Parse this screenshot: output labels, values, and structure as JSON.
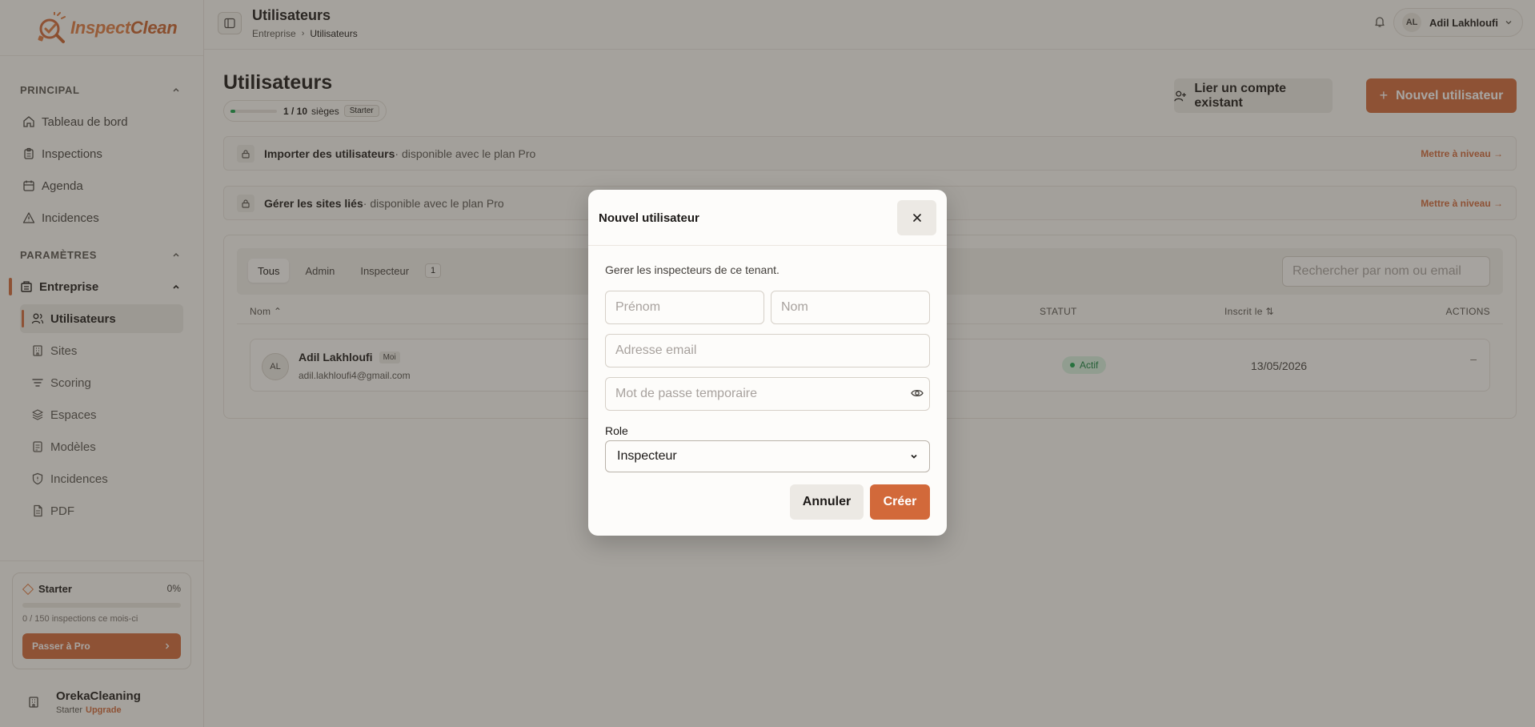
{
  "app": {
    "brand_part1": "Inspect",
    "brand_part2": "Clean",
    "accent_color": "#d2693a"
  },
  "sidebar": {
    "section_principal": "PRINCIPAL",
    "principal_items": [
      {
        "label": "Tableau de bord",
        "icon": "home-icon"
      },
      {
        "label": "Inspections",
        "icon": "clipboard-icon"
      },
      {
        "label": "Agenda",
        "icon": "calendar-icon"
      },
      {
        "label": "Incidences",
        "icon": "alert-triangle-icon"
      }
    ],
    "section_params": "PARAMÈTRES",
    "parent_item": "Entreprise",
    "sub_items": [
      {
        "label": "Utilisateurs",
        "icon": "users-icon"
      },
      {
        "label": "Sites",
        "icon": "building-icon"
      },
      {
        "label": "Scoring",
        "icon": "chart-icon"
      },
      {
        "label": "Espaces",
        "icon": "layers-icon"
      },
      {
        "label": "Modèles",
        "icon": "template-icon"
      },
      {
        "label": "Incidences",
        "icon": "shield-icon"
      },
      {
        "label": "PDF",
        "icon": "file-icon"
      }
    ],
    "plan": {
      "name": "Starter",
      "percent": "0%",
      "usage_fraction": 0,
      "usage": "0 / 150 inspections ce mois-ci",
      "upgrade_label": "Passer à Pro"
    },
    "org": {
      "name": "OrekaCleaning",
      "plan": "Starter",
      "upgrade": "Upgrade"
    }
  },
  "header": {
    "title": "Utilisateurs",
    "breadcrumb_root": "Entreprise",
    "breadcrumb_current": "Utilisateurs",
    "user_initials": "AL",
    "user_name": "Adil Lakhloufi"
  },
  "main": {
    "title": "Utilisateurs",
    "seats_count": "1 / 10",
    "seats_label": "sièges",
    "seats_fraction": 0.1,
    "seats_plan": "Starter",
    "link_account_label": "Lier un compte existant",
    "new_user_label": "Nouvel utilisateur",
    "promos": [
      {
        "bold": "Importer des utilisateurs",
        "rest": "· disponible avec le plan Pro",
        "cta": "Mettre à niveau →"
      },
      {
        "bold": "Gérer les sites liés",
        "rest": "· disponible avec le plan Pro",
        "cta": "Mettre à niveau →"
      }
    ],
    "tabs": [
      "Tous",
      "Admin",
      "Inspecteur"
    ],
    "tab_count": "1",
    "search_placeholder": "Rechercher par nom ou email",
    "columns": {
      "name": "Nom",
      "status": "STATUT",
      "registered": "Inscrit le",
      "actions": "ACTIONS"
    },
    "rows": [
      {
        "initials": "AL",
        "name": "Adil Lakhloufi",
        "badge": "Moi",
        "email": "adil.lakhloufi4@gmail.com",
        "status": "Actif",
        "date": "13/05/2026",
        "action": "–"
      }
    ]
  },
  "modal": {
    "title": "Nouvel utilisateur",
    "description": "Gerer les inspecteurs de ce tenant.",
    "first_name_placeholder": "Prénom",
    "last_name_placeholder": "Nom",
    "email_placeholder": "Adresse email",
    "password_placeholder": "Mot de passe temporaire",
    "role_label": "Role",
    "role_value": "Inspecteur",
    "cancel_label": "Annuler",
    "create_label": "Créer"
  }
}
